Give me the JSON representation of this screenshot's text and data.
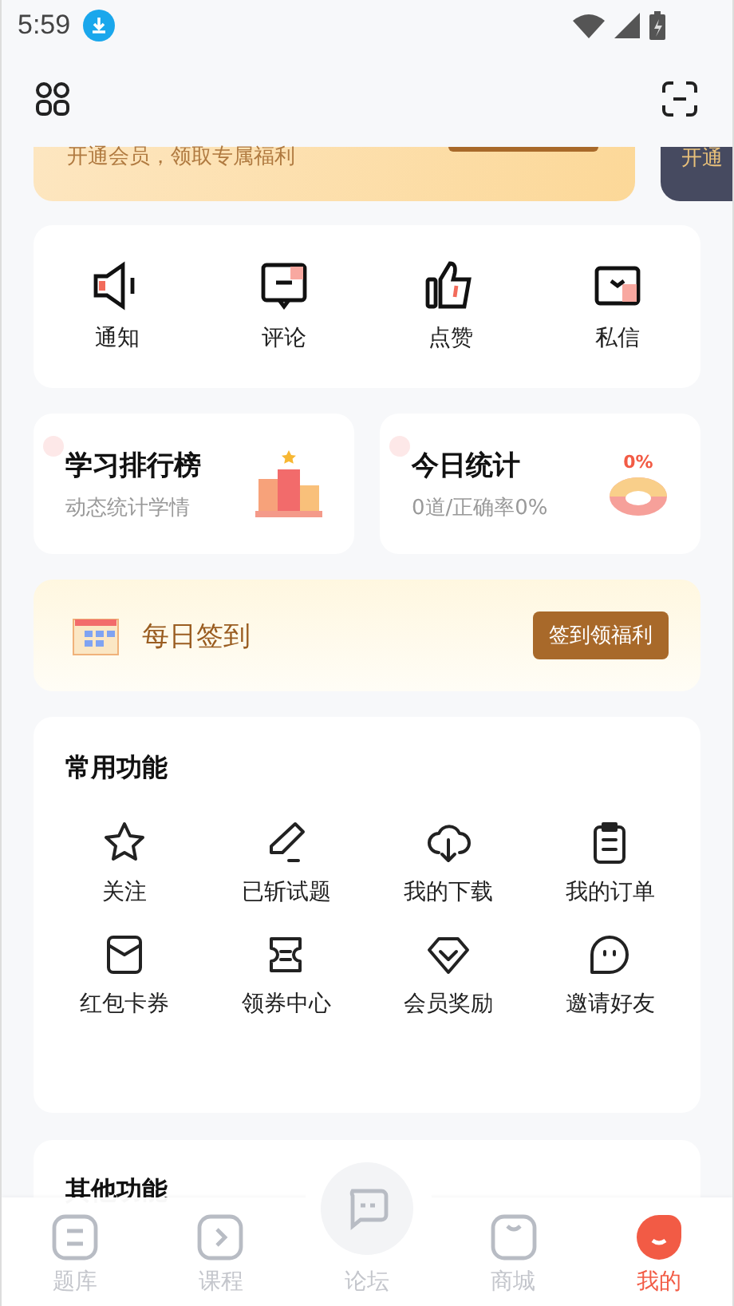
{
  "status_bar": {
    "time": "5:59"
  },
  "vip_banners": [
    {
      "subtitle": "开通会员，领取专属福利"
    },
    {
      "subtitle": "开通"
    }
  ],
  "messages": [
    {
      "label": "通知"
    },
    {
      "label": "评论"
    },
    {
      "label": "点赞"
    },
    {
      "label": "私信"
    }
  ],
  "stat_cards": [
    {
      "title": "学习排行榜",
      "subtitle": "动态统计学情"
    },
    {
      "title": "今日统计",
      "subtitle": "0道/正确率0%",
      "badge": "0%"
    }
  ],
  "checkin": {
    "title": "每日签到",
    "button": "签到领福利"
  },
  "common": {
    "title": "常用功能",
    "items": [
      {
        "label": "关注"
      },
      {
        "label": "已斩试题"
      },
      {
        "label": "我的下载"
      },
      {
        "label": "我的订单"
      },
      {
        "label": "红包卡券"
      },
      {
        "label": "领券中心"
      },
      {
        "label": "会员奖励"
      },
      {
        "label": "邀请好友"
      }
    ]
  },
  "other": {
    "title": "其他功能"
  },
  "tabs": [
    {
      "label": "题库",
      "selected": false
    },
    {
      "label": "课程",
      "selected": false
    },
    {
      "label": "论坛",
      "selected": false
    },
    {
      "label": "商城",
      "selected": false
    },
    {
      "label": "我的",
      "selected": true
    }
  ]
}
